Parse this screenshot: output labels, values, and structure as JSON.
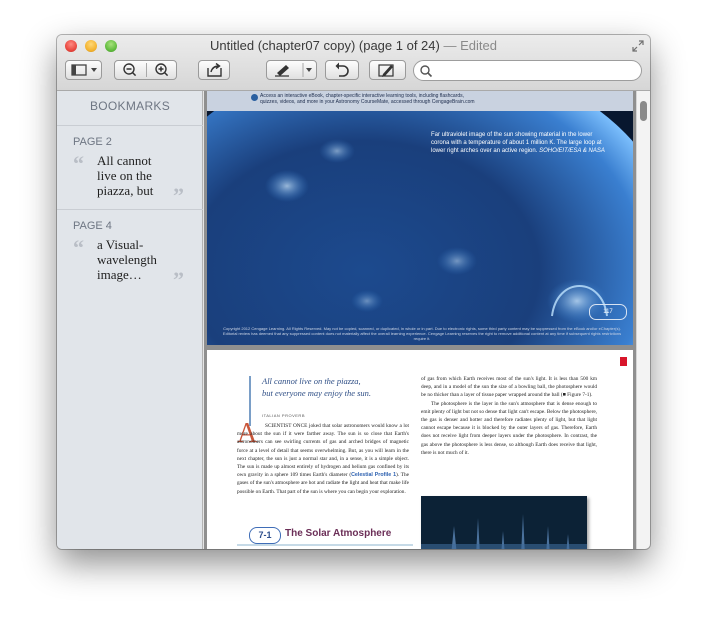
{
  "window": {
    "title": "Untitled (chapter07 copy) (page 1 of 24)",
    "title_status": "— Edited",
    "icons": {
      "close": "close-icon",
      "minimize": "minimize-icon",
      "zoom": "zoom-icon",
      "fullscreen": "fullscreen-icon"
    }
  },
  "toolbar": {
    "view_icon": "sidebar-view-icon",
    "zoom_out_icon": "zoom-out-icon",
    "zoom_in_icon": "zoom-in-icon",
    "share_icon": "share-icon",
    "markup_icon": "highlighter-icon",
    "rotate_icon": "rotate-icon",
    "annotate_icon": "pencil-icon",
    "search_icon": "search-icon",
    "search_value": ""
  },
  "sidebar": {
    "heading": "BOOKMARKS",
    "bookmarks": [
      {
        "page": "PAGE 2",
        "text": "All cannot live on the piazza, but"
      },
      {
        "page": "PAGE 4",
        "text": "a Visual-wavelength image…"
      }
    ]
  },
  "document": {
    "banner": "Access an interactive eBook, chapter-specific interactive learning tools, including flashcards,\nquizzes, videos, and more in your Astronomy CourseMate, accessed through CengageBrain.com",
    "image_caption": "Far ultraviolet image of the sun showing material in the lower corona with a temperature of about 1 million K. The large loop at lower right arches over an active region.",
    "image_credit": "SOHO/EIT/ESA & NASA",
    "page_number": "117",
    "copyright": "Copyright 2012 Cengage Learning. All Rights Reserved. May not be copied, scanned, or duplicated, in whole or in part. Due to electronic rights, some third party content may be suppressed from the eBook and/or eChapter(s). Editorial review has deemed that any suppressed content does not materially affect the overall learning experience. Cengage Learning reserves the right to remove additional content at any time if subsequent rights restrictions require it.",
    "epigraph_line1": "All cannot live on the piazza,",
    "epigraph_line2": "but everyone may enjoy the sun.",
    "epigraph_source": "ITALIAN PROVERB",
    "dropcap": "A",
    "body_left": "SCIENTIST ONCE joked that solar astronomers would know a lot more about the sun if it were farther away. The sun is so close that Earth's astronomers can see swirling currents of gas and arched bridges of magnetic force at a level of detail that seems overwhelming. But, as you will learn in the next chapter, the sun is just a normal star and, in a sense, it is a simple object. The sun is made up almost entirely of hydrogen and helium gas confined by its own gravity in a sphere 109 times Earth's diameter",
    "celestial_profile": "Celestial Profile 1",
    "body_left_end": "). The gases of the sun's atmosphere are hot and radiate the light and heat that make life possible on Earth. That part of the sun is where you can begin your exploration.",
    "body_right_1": "of gas from which Earth receives most of the sun's light. It is less than 500 km deep, and in a model of the sun the size of a bowling ball, the photosphere would be no thicker than a layer of tissue paper wrapped around the ball (■ Figure 7-1).",
    "body_right_2": "The photosphere is the layer in the sun's atmosphere that is dense enough to emit plenty of light but not so dense that light can't escape. Below the photosphere, the gas is denser and hotter and therefore radiates plenty of light, but that light cannot escape because it is blocked by the outer layers of gas. Therefore, Earth does not receive light from deeper layers under the photosphere. In contrast, the gas above the photosphere is less dense, so although Earth does receive that light, there is not much of it.",
    "section_number": "7-1",
    "section_title": "The Solar Atmosphere"
  }
}
